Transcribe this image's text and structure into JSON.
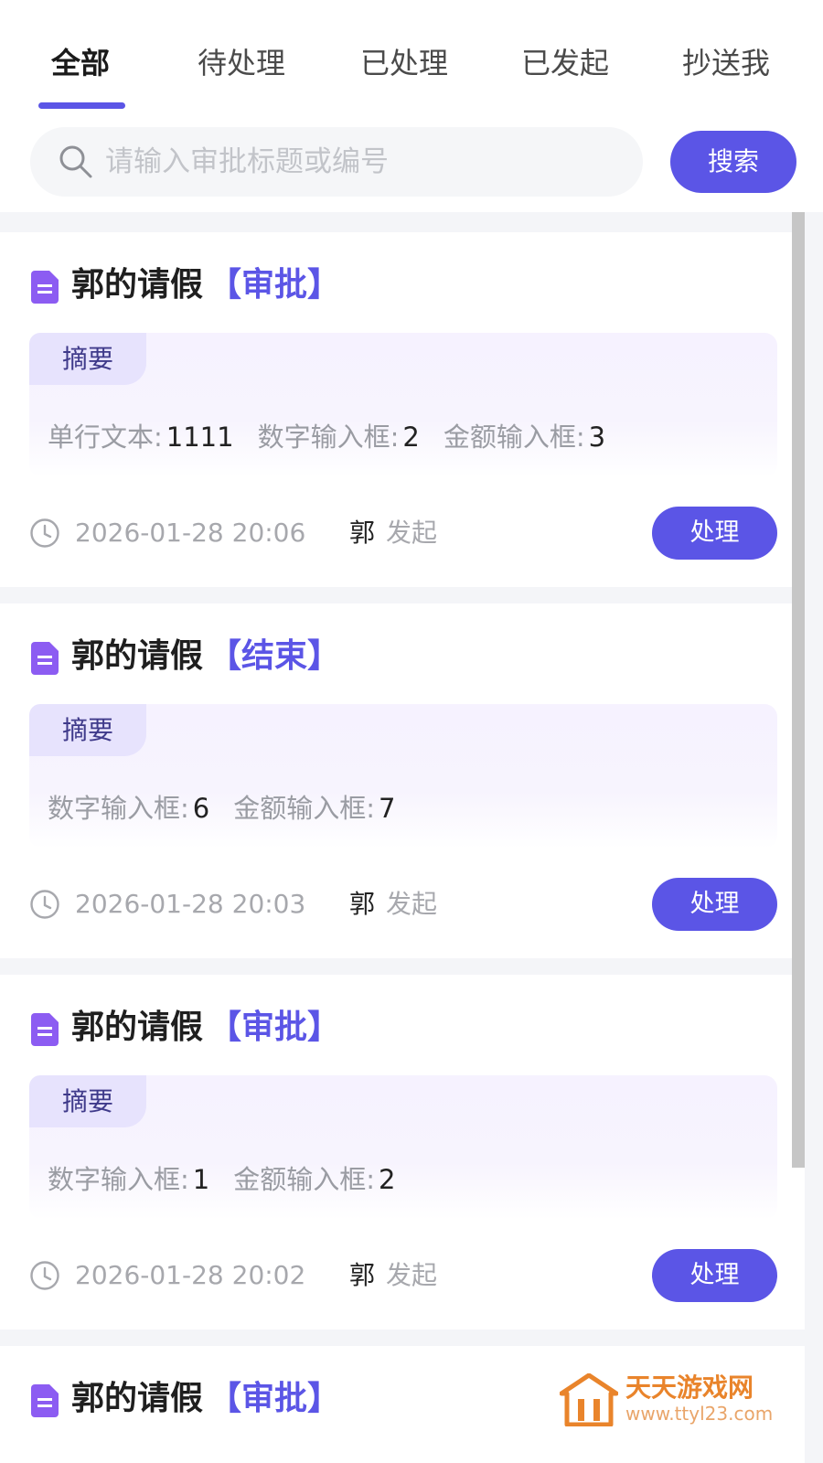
{
  "tabs": [
    {
      "label": "全部",
      "active": true
    },
    {
      "label": "待处理",
      "active": false
    },
    {
      "label": "已处理",
      "active": false
    },
    {
      "label": "已发起",
      "active": false
    },
    {
      "label": "抄送我",
      "active": false
    }
  ],
  "search": {
    "placeholder": "请输入审批标题或编号",
    "value": "",
    "button_label": "搜索"
  },
  "cards": [
    {
      "title": "郭的请假",
      "status": "【审批】",
      "summary_label": "摘要",
      "fields": [
        {
          "label": "单行文本:",
          "value": "1111"
        },
        {
          "label": "数字输入框:",
          "value": "2"
        },
        {
          "label": "金额输入框:",
          "value": "3"
        }
      ],
      "time": "2026-01-28 20:06",
      "initiator": "郭",
      "action_text": "发起",
      "button_label": "处理"
    },
    {
      "title": "郭的请假",
      "status": "【结束】",
      "summary_label": "摘要",
      "fields": [
        {
          "label": "数字输入框:",
          "value": "6"
        },
        {
          "label": "金额输入框:",
          "value": "7"
        }
      ],
      "time": "2026-01-28 20:03",
      "initiator": "郭",
      "action_text": "发起",
      "button_label": "处理"
    },
    {
      "title": "郭的请假",
      "status": "【审批】",
      "summary_label": "摘要",
      "fields": [
        {
          "label": "数字输入框:",
          "value": "1"
        },
        {
          "label": "金额输入框:",
          "value": "2"
        }
      ],
      "time": "2026-01-28 20:02",
      "initiator": "郭",
      "action_text": "发起",
      "button_label": "处理"
    },
    {
      "title": "郭的请假",
      "status": "【审批】"
    }
  ],
  "watermark": {
    "name": "天天游戏网",
    "url": "www.ttyl23.com"
  },
  "colors": {
    "accent": "#5b55e6",
    "summary_tag_bg": "#e7e3fd",
    "muted_text": "#a7a8ad",
    "page_bg": "#f4f5f8",
    "watermark": "#e9842b"
  },
  "icons": {
    "search": "search-icon",
    "document": "document-icon",
    "clock": "clock-icon",
    "watermark_logo": "house-logo-icon"
  }
}
